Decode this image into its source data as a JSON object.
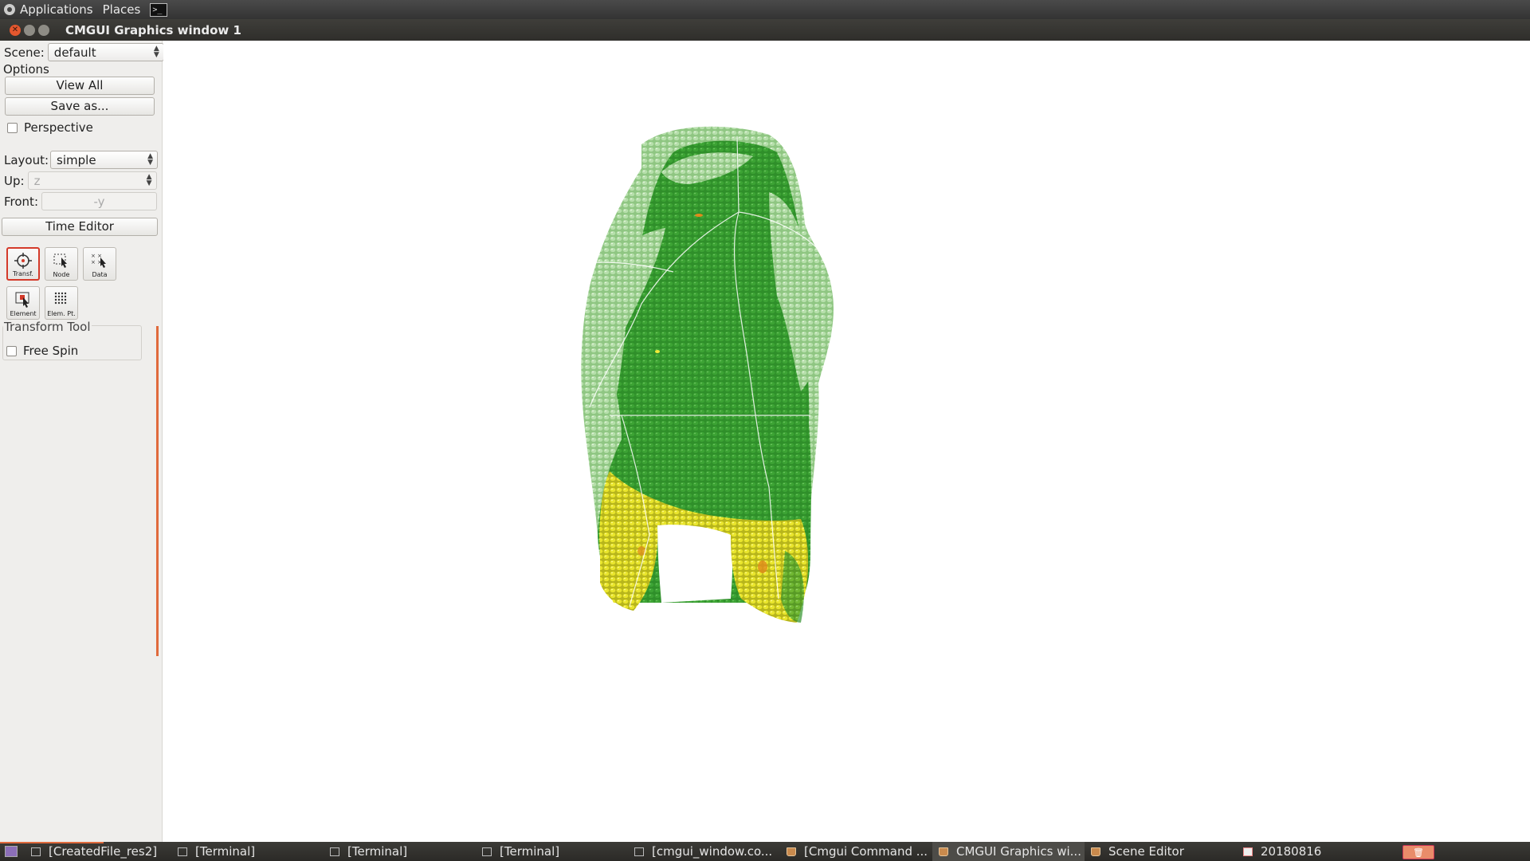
{
  "top_panel": {
    "applications": "Applications",
    "places": "Places",
    "terminal_glyph": ">_"
  },
  "window": {
    "title": "CMGUI Graphics window 1"
  },
  "left_panel": {
    "scene_label": "Scene:",
    "scene_value": "default",
    "options_label": "Options",
    "view_all": "View All",
    "save_as": "Save as...",
    "perspective_label": "Perspective",
    "perspective_checked": false,
    "layout_label": "Layout:",
    "layout_value": "simple",
    "up_label": "Up:",
    "up_value": "z",
    "front_label": "Front:",
    "front_value": "-y",
    "time_editor": "Time Editor",
    "tools": [
      {
        "label": "Transf.",
        "icon": "transform-tool-icon",
        "selected": true
      },
      {
        "label": "Node",
        "icon": "node-tool-icon",
        "selected": false
      },
      {
        "label": "Data",
        "icon": "data-tool-icon",
        "selected": false
      },
      {
        "label": "Element",
        "icon": "element-tool-icon",
        "selected": false
      },
      {
        "label": "Elem. Pt.",
        "icon": "element-point-tool-icon",
        "selected": false
      }
    ],
    "transform_tool_label": "Transform Tool",
    "free_spin_label": "Free Spin",
    "free_spin_checked": false
  },
  "scene_colors": {
    "dark_green": "#2f8f2a",
    "light_green": "#a9d69d",
    "yellow": "#e6e22a",
    "orange": "#e08a1c"
  },
  "taskbar": {
    "items": [
      {
        "label": "[CreatedFile_res2]",
        "icon": "window-icon",
        "active": false
      },
      {
        "label": "[Terminal]",
        "icon": "terminal-icon",
        "active": false
      },
      {
        "label": "[Terminal]",
        "icon": "terminal-icon",
        "active": false
      },
      {
        "label": "[Terminal]",
        "icon": "terminal-icon",
        "active": false
      },
      {
        "label": "[cmgui_window.co...",
        "icon": "text-editor-icon",
        "active": false
      },
      {
        "label": "[Cmgui Command ...",
        "icon": "cmgui-icon",
        "active": false
      },
      {
        "label": "CMGUI Graphics wi...",
        "icon": "cmgui-icon",
        "active": true
      },
      {
        "label": "Scene Editor",
        "icon": "cmgui-icon",
        "active": false
      },
      {
        "label": "20180816",
        "icon": "calendar-icon",
        "active": false
      }
    ]
  }
}
